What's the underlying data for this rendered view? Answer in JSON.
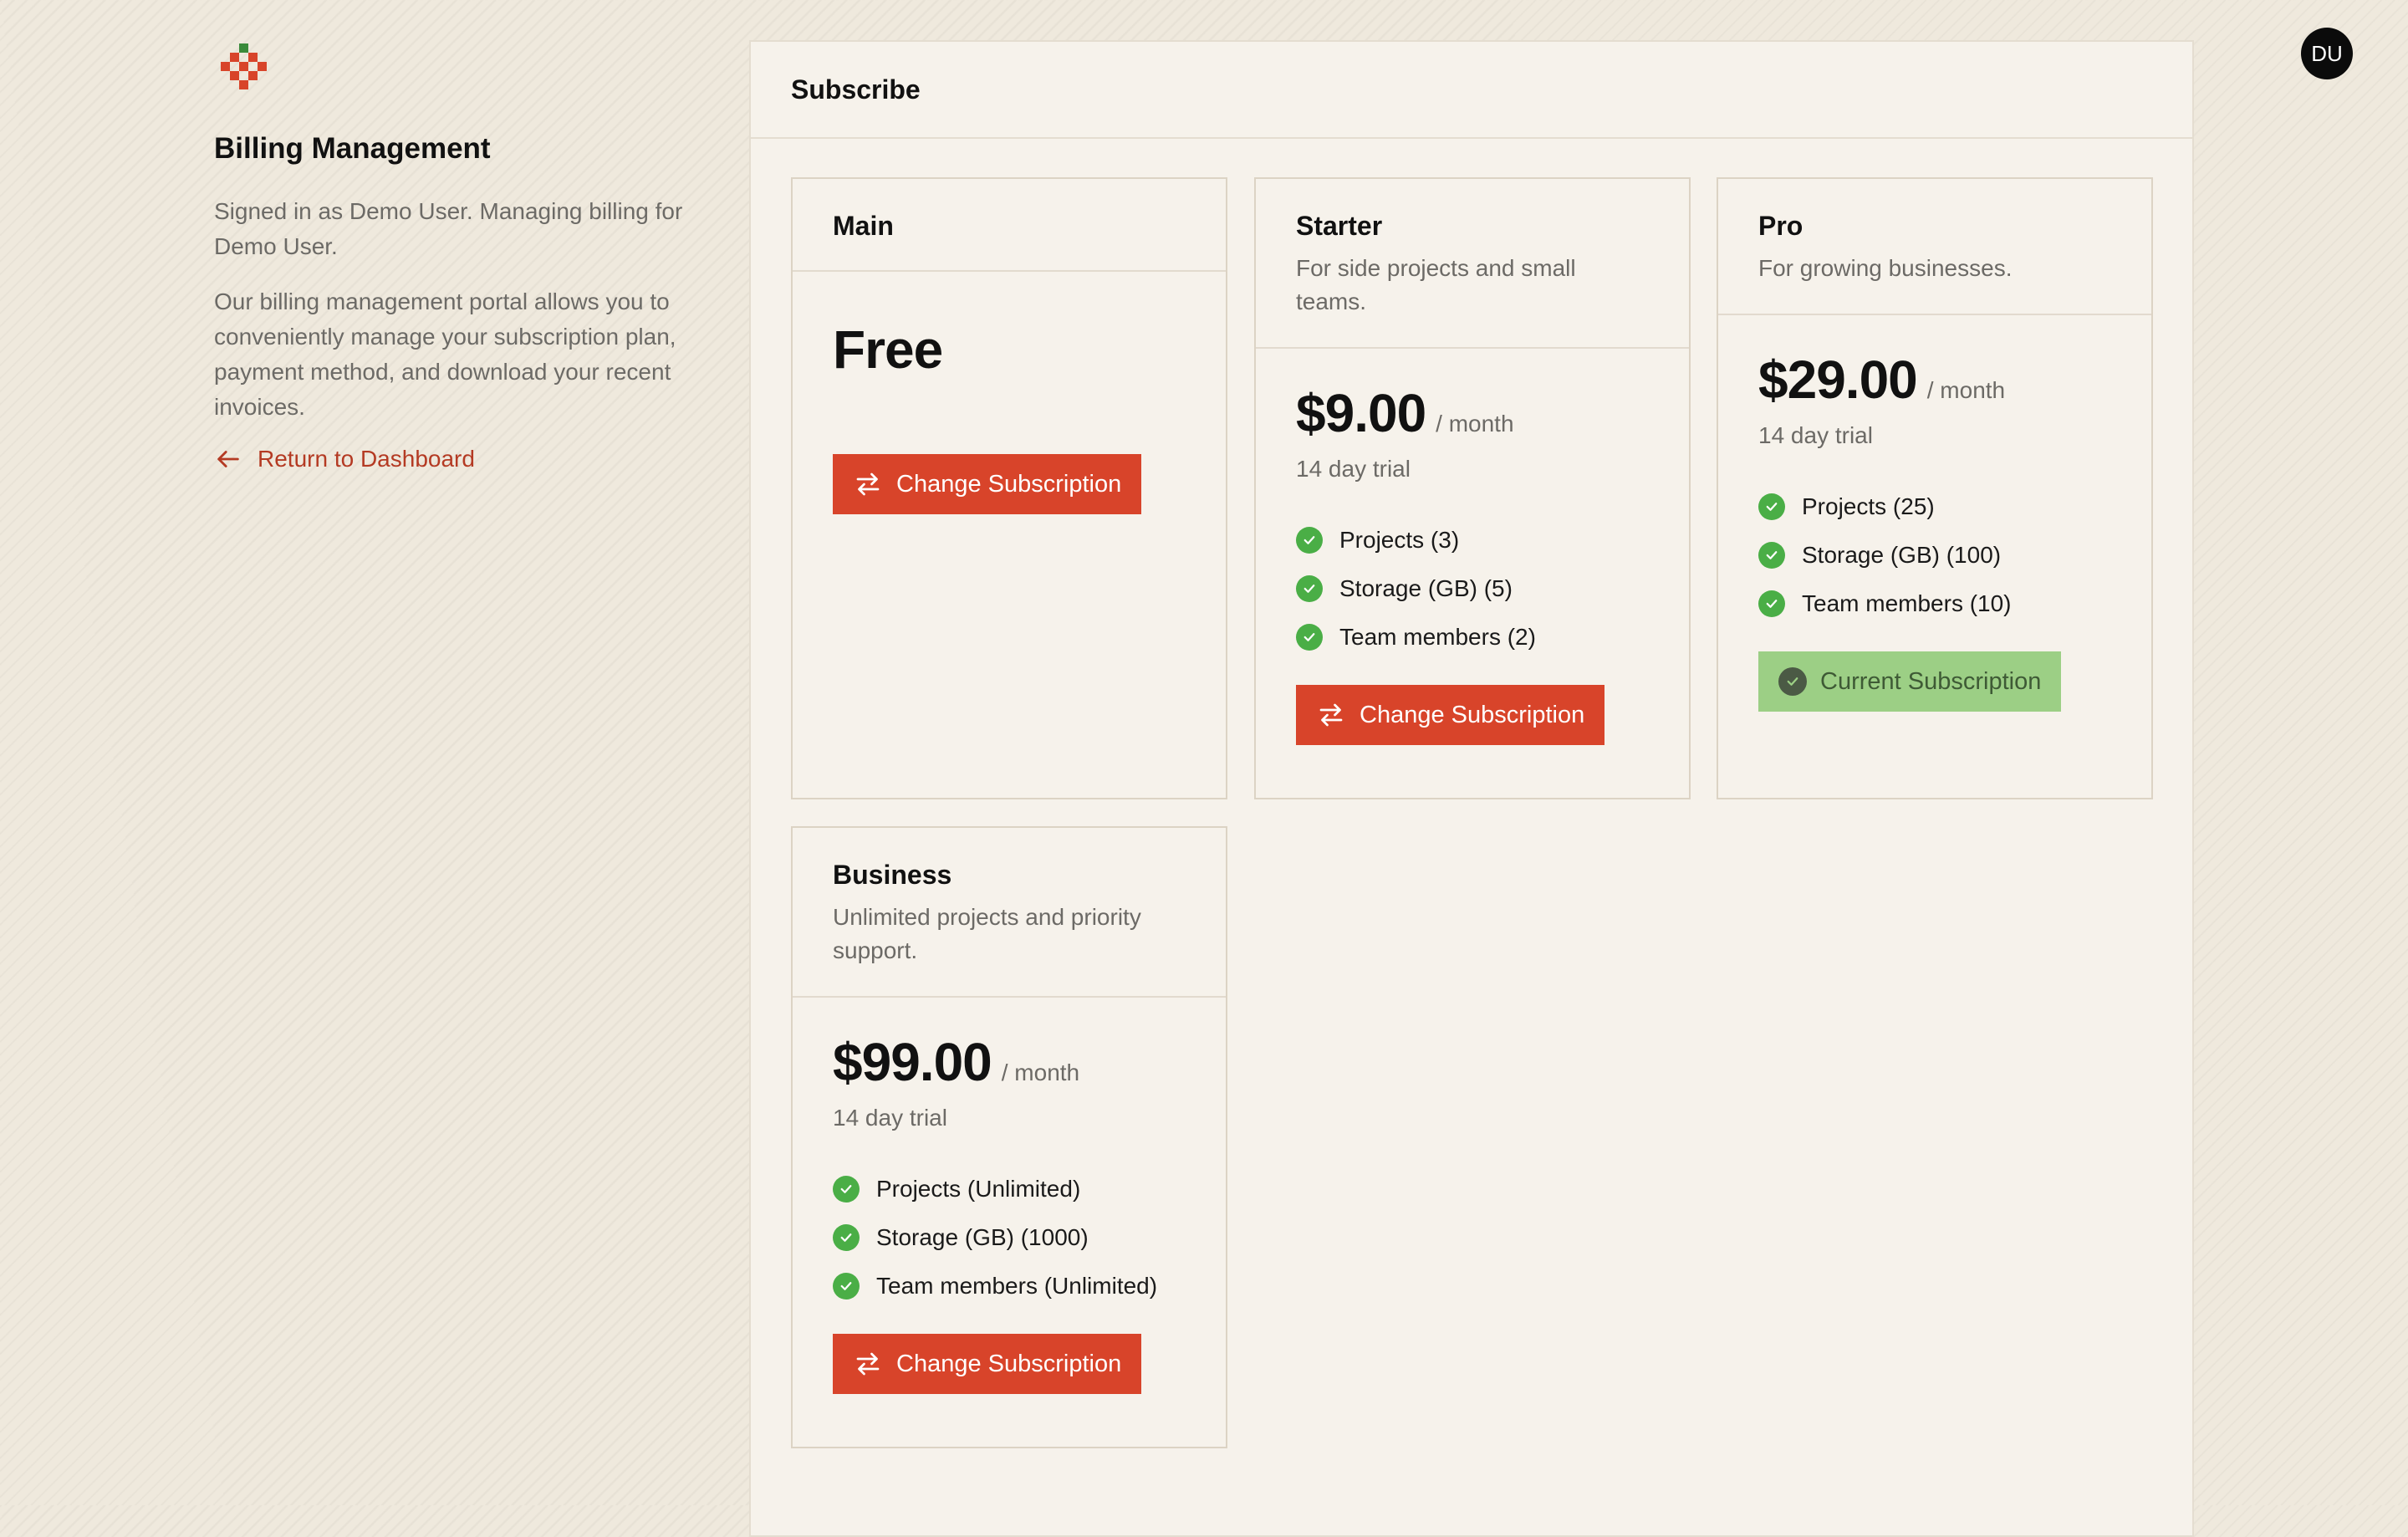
{
  "sidebar": {
    "title": "Billing Management",
    "signed_in_text": "Signed in as Demo User. Managing billing for Demo User.",
    "description": "Our billing management portal allows you to conveniently manage your subscription plan, payment method, and download your recent invoices.",
    "back_link": "Return to Dashboard"
  },
  "user": {
    "initials": "DU"
  },
  "panel": {
    "title": "Subscribe"
  },
  "plans": [
    {
      "name": "Main",
      "price": "Free",
      "change_label": "Change Subscription"
    },
    {
      "name": "Starter",
      "description": "For side projects and small teams.",
      "price": "$9.00",
      "period": "/ month",
      "trial": "14 day trial",
      "features": [
        "Projects (3)",
        "Storage (GB) (5)",
        "Team members (2)"
      ],
      "change_label": "Change Subscription"
    },
    {
      "name": "Pro",
      "description": "For growing businesses.",
      "price": "$29.00",
      "period": "/ month",
      "trial": "14 day trial",
      "features": [
        "Projects (25)",
        "Storage (GB) (100)",
        "Team members (10)"
      ],
      "current_label": "Current Subscription"
    },
    {
      "name": "Business",
      "description": "Unlimited projects and priority support.",
      "price": "$99.00",
      "period": "/ month",
      "trial": "14 day trial",
      "features": [
        "Projects (Unlimited)",
        "Storage (GB) (1000)",
        "Team members (Unlimited)"
      ],
      "change_label": "Change Subscription"
    }
  ],
  "colors": {
    "accent": "#d8442a",
    "link": "#b43a23",
    "check": "#4aae46",
    "current": "#9ccf85"
  }
}
